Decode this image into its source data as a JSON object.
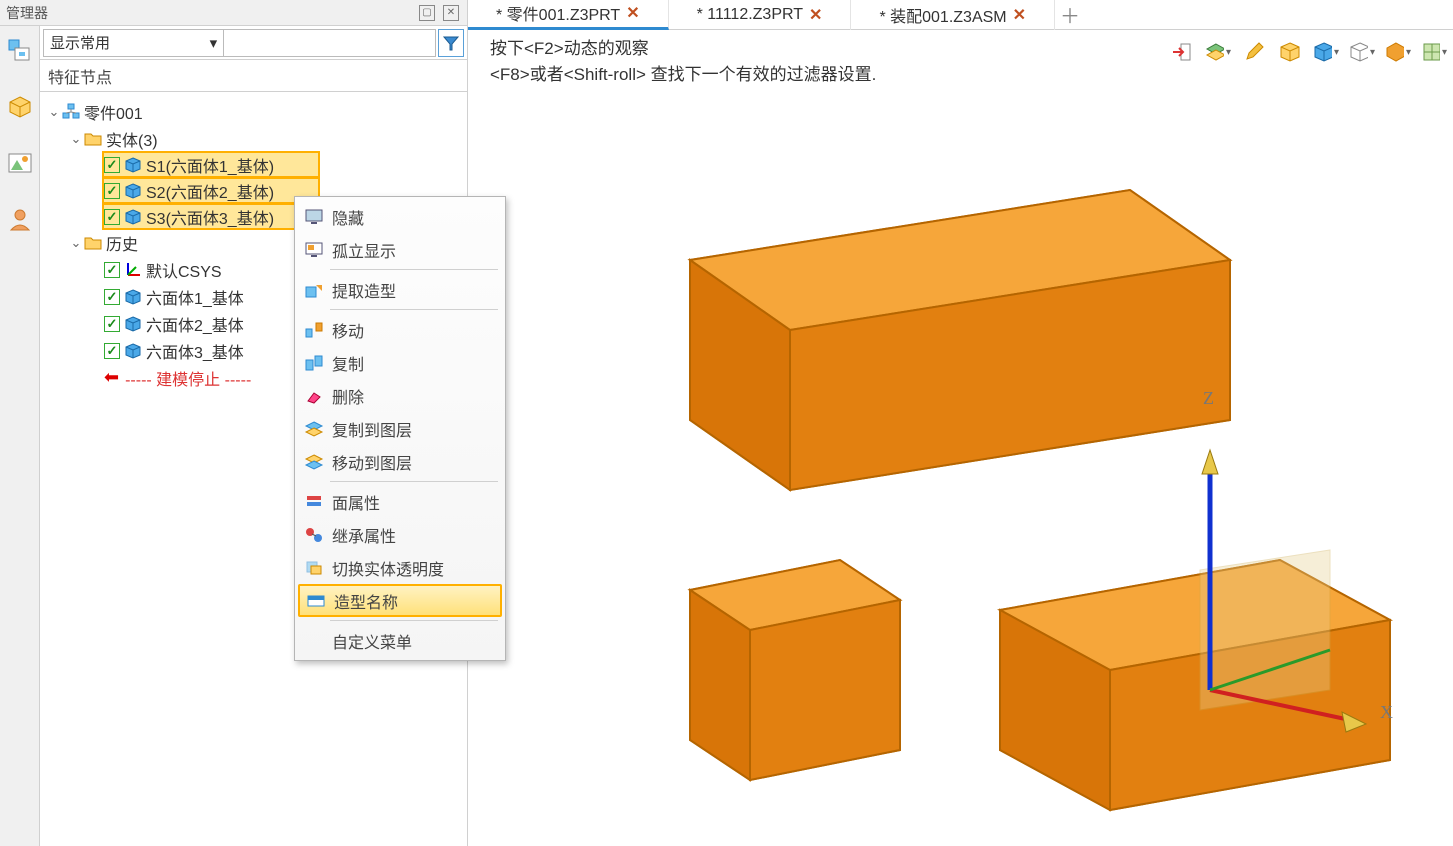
{
  "manager": {
    "title": "管理器",
    "filter_select": "显示常用",
    "filter_input": "",
    "section": "特征节点"
  },
  "tree": {
    "root": "零件001",
    "solids_folder": "实体(3)",
    "solids": [
      "S1(六面体1_基体)",
      "S2(六面体2_基体)",
      "S3(六面体3_基体)"
    ],
    "history_folder": "历史",
    "history": [
      "默认CSYS",
      "六面体1_基体",
      "六面体2_基体",
      "六面体3_基体"
    ],
    "stop": "----- 建模停止 -----"
  },
  "context_menu": {
    "items": [
      "隐藏",
      "孤立显示",
      "提取造型",
      "移动",
      "复制",
      "删除",
      "复制到图层",
      "移动到图层",
      "面属性",
      "继承属性",
      "切换实体透明度",
      "造型名称",
      "自定义菜单"
    ],
    "highlight_index": 11
  },
  "tabs": [
    {
      "label": "* 零件001.Z3PRT",
      "active": true
    },
    {
      "label": "* 11112.Z3PRT",
      "active": false
    },
    {
      "label": "* 装配001.Z3ASM",
      "active": false
    }
  ],
  "hint": {
    "line1": "按下<F2>动态的观察",
    "line2": "<F8>或者<Shift-roll> 查找下一个有效的过滤器设置."
  },
  "axes": {
    "x": "X",
    "z": "Z"
  },
  "colors": {
    "solid_fill": "#ef8f17",
    "solid_edge": "#b56500",
    "highlight_bg": "#ffe79a",
    "highlight_border": "#ffb000",
    "tab_underline": "#2e8ad0"
  }
}
